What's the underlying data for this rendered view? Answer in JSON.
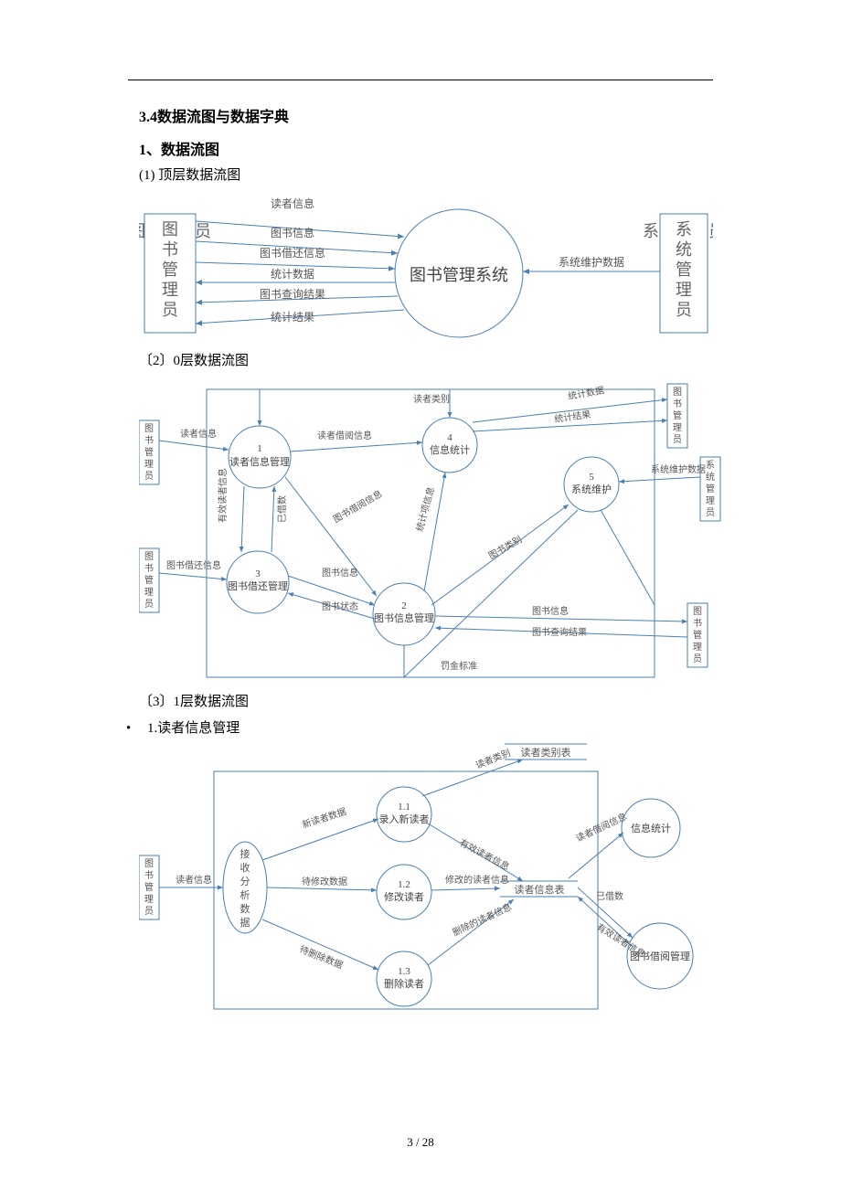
{
  "page_number": "3 / 28",
  "headings": {
    "h34": "3.4数据流图与数据字典",
    "h1": "1、数据流图",
    "h1_1": "(1) 顶层数据流图",
    "h1_2": "〔2〕0层数据流图",
    "h1_3": "〔3〕1层数据流图",
    "bullet_1": "1.读者信息管理"
  },
  "diagram_top": {
    "left_box": "图书管理员",
    "right_box": "系统管理员",
    "center": "图书管理系统",
    "flows_left": [
      "读者信息",
      "图书信息",
      "图书借还信息",
      "统计数据",
      "图书查询结果",
      "统计结果"
    ],
    "flow_right": "系统维护数据"
  },
  "diagram_mid": {
    "ext_left_top": "图书管理员",
    "ext_left_bot": "图书管理员",
    "ext_right_top": "图书管理员",
    "ext_right_mid": "系统管理员",
    "ext_right_bot": "图书管理员",
    "p1": {
      "num": "1",
      "name": "读者信息管理"
    },
    "p2": {
      "num": "2",
      "name": "图书信息管理"
    },
    "p3": {
      "num": "3",
      "name": "图书借还管理"
    },
    "p4": {
      "num": "4",
      "name": "信息统计"
    },
    "p5": {
      "num": "5",
      "name": "系统维护"
    },
    "labels": {
      "reader_info": "读者信息",
      "reader_cat": "读者类别",
      "reader_borrow": "读者借阅信息",
      "stat_data": "统计数据",
      "stat_result": "统计结果",
      "sys_maint": "系统维护数据",
      "book_borrow_ret": "图书借还信息",
      "valid_reader": "有效读者信息",
      "borrowed": "已借数",
      "book_borrow_info": "图书借阅信息",
      "stat_item": "统计项信息",
      "book_info": "图书信息",
      "book_status": "图书状态",
      "book_cat": "图书类别",
      "book_info2": "图书信息",
      "book_query": "图书查询结果",
      "fine": "罚金标准"
    }
  },
  "diagram_bot": {
    "ext_left": "图书管理员",
    "node_recv": "接收分析数据",
    "p11": {
      "num": "1.1",
      "name": "录入新读者"
    },
    "p12": {
      "num": "1.2",
      "name": "修改读者"
    },
    "p13": {
      "num": "1.3",
      "name": "删除读者"
    },
    "store_top": "读者类别表",
    "store_mid": "读者信息表",
    "out_stat": "信息统计",
    "out_borrow": "图书借阅管理",
    "labels": {
      "reader_info": "读者信息",
      "new_reader": "新读者数据",
      "to_modify": "待修改数据",
      "to_delete": "待删除数据",
      "reader_cat": "读者类别",
      "valid_reader": "有效读者信息",
      "modified": "修改的读者信息",
      "deleted": "删除的读者信息",
      "reader_borrow": "读者借阅信息",
      "borrowed": "已借数",
      "valid_reader2": "有效读者信息"
    }
  }
}
